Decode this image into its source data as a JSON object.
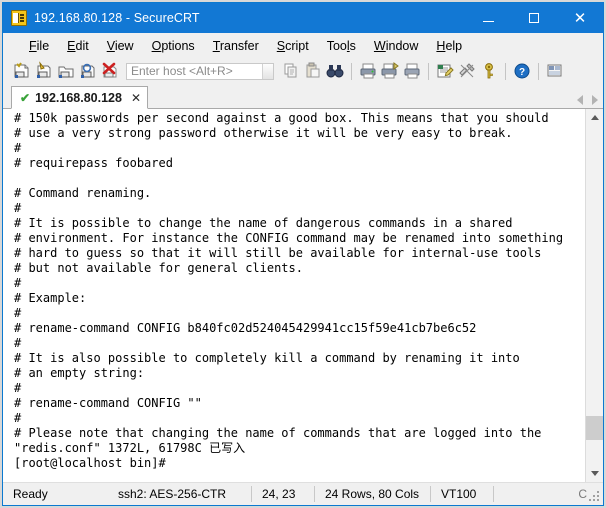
{
  "window": {
    "title": "192.168.80.128 - SecureCRT",
    "icon": "securecrt-app-icon",
    "minimize_label": "–",
    "maximize_label": "□",
    "close_label": "✕"
  },
  "menu": {
    "items": [
      {
        "label": "File",
        "mnemonic": "F"
      },
      {
        "label": "Edit",
        "mnemonic": "E"
      },
      {
        "label": "View",
        "mnemonic": "V"
      },
      {
        "label": "Options",
        "mnemonic": "O"
      },
      {
        "label": "Transfer",
        "mnemonic": "T"
      },
      {
        "label": "Script",
        "mnemonic": "S"
      },
      {
        "label": "Tools",
        "mnemonic": "l"
      },
      {
        "label": "Window",
        "mnemonic": "W"
      },
      {
        "label": "Help",
        "mnemonic": "H"
      }
    ]
  },
  "toolbar": {
    "host_field": {
      "value": "",
      "placeholder": "Enter host <Alt+R>"
    },
    "icons": [
      "new-session-icon",
      "connect-session-icon",
      "connect-in-tab-icon",
      "quick-connect-icon",
      "disconnect-icon",
      "copy-icon",
      "paste-icon",
      "find-icon",
      "print-icon",
      "print-selection-icon",
      "print-screen-icon",
      "log-session-icon",
      "session-options-icon",
      "key-icon",
      "help-icon",
      "arrange-windows-icon"
    ]
  },
  "tabs": {
    "items": [
      {
        "label": "192.168.80.128",
        "status_icon": "connected-check-icon",
        "close_label": "✕",
        "active": true
      }
    ],
    "nav_prev": "tab-scroll-left",
    "nav_next": "tab-scroll-right"
  },
  "terminal": {
    "rows": 24,
    "cols": 80,
    "lines": [
      "# 150k passwords per second against a good box. This means that you should",
      "# use a very strong password otherwise it will be very easy to break.",
      "#",
      "# requirepass foobared",
      "",
      "# Command renaming.",
      "#",
      "# It is possible to change the name of dangerous commands in a shared",
      "# environment. For instance the CONFIG command may be renamed into something",
      "# hard to guess so that it will still be available for internal-use tools",
      "# but not available for general clients.",
      "#",
      "# Example:",
      "#",
      "# rename-command CONFIG b840fc02d524045429941cc15f59e41cb7be6c52",
      "#",
      "# It is also possible to completely kill a command by renaming it into",
      "# an empty string:",
      "#",
      "# rename-command CONFIG \"\"",
      "#",
      "# Please note that changing the name of commands that are logged into the",
      "\"redis.conf\" 1372L, 61798C 已写入",
      "[root@localhost bin]#"
    ]
  },
  "scrollbar": {
    "up_arrow": "scroll-up-icon",
    "down_arrow": "scroll-down-icon",
    "thumb_position_percent": 92,
    "thumb_size_percent": 7
  },
  "status_bar": {
    "ready": "Ready",
    "protocol": "ssh2: AES-256-CTR",
    "cursor": "24, 23",
    "dimensions": "24 Rows, 80 Cols",
    "emulation": "VT100",
    "capture": "C"
  },
  "colors": {
    "title_bar": "#1278d4",
    "window_border": "#0b79d0",
    "chrome": "#f0f0f0",
    "terminal_bg": "#ffffff",
    "terminal_fg": "#000000",
    "tab_check": "#3aa33a"
  }
}
